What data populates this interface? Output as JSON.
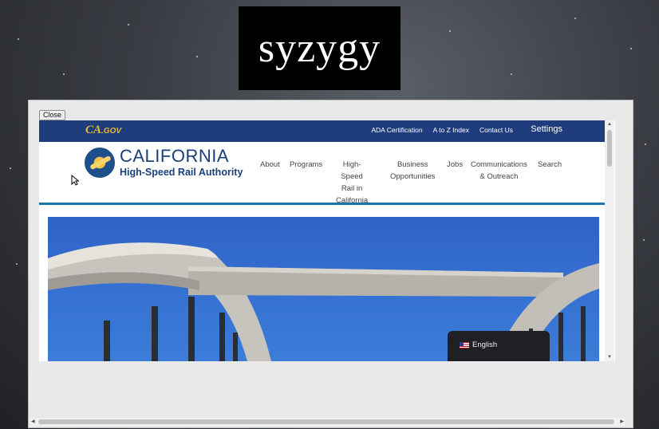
{
  "logo": {
    "text": "syzygy"
  },
  "popup": {
    "close_label": "Close"
  },
  "utility_bar": {
    "cagov": "CA",
    "cagov_suffix": ".GOV",
    "links": [
      "ADA Certification",
      "A to Z Index",
      "Contact Us"
    ],
    "settings": "Settings"
  },
  "brand": {
    "title": "CALIFORNIA",
    "subtitle": "High-Speed Rail Authority"
  },
  "nav": {
    "about": "About",
    "programs": "Programs",
    "hsr_line1": "High-Speed",
    "hsr_line2": "Rail in",
    "hsr_line3": "California",
    "business_line1": "Business",
    "business_line2": "Opportunities",
    "jobs": "Jobs",
    "comm_line1": "Communications",
    "comm_line2": "& Outreach",
    "search": "Search"
  },
  "language": {
    "label": "English"
  },
  "colors": {
    "utility_bar": "#1f3d7d",
    "brand": "#1b3f7a",
    "rule": "#1577a8",
    "sky": "#3673d4",
    "concrete": "#bdbab4"
  }
}
